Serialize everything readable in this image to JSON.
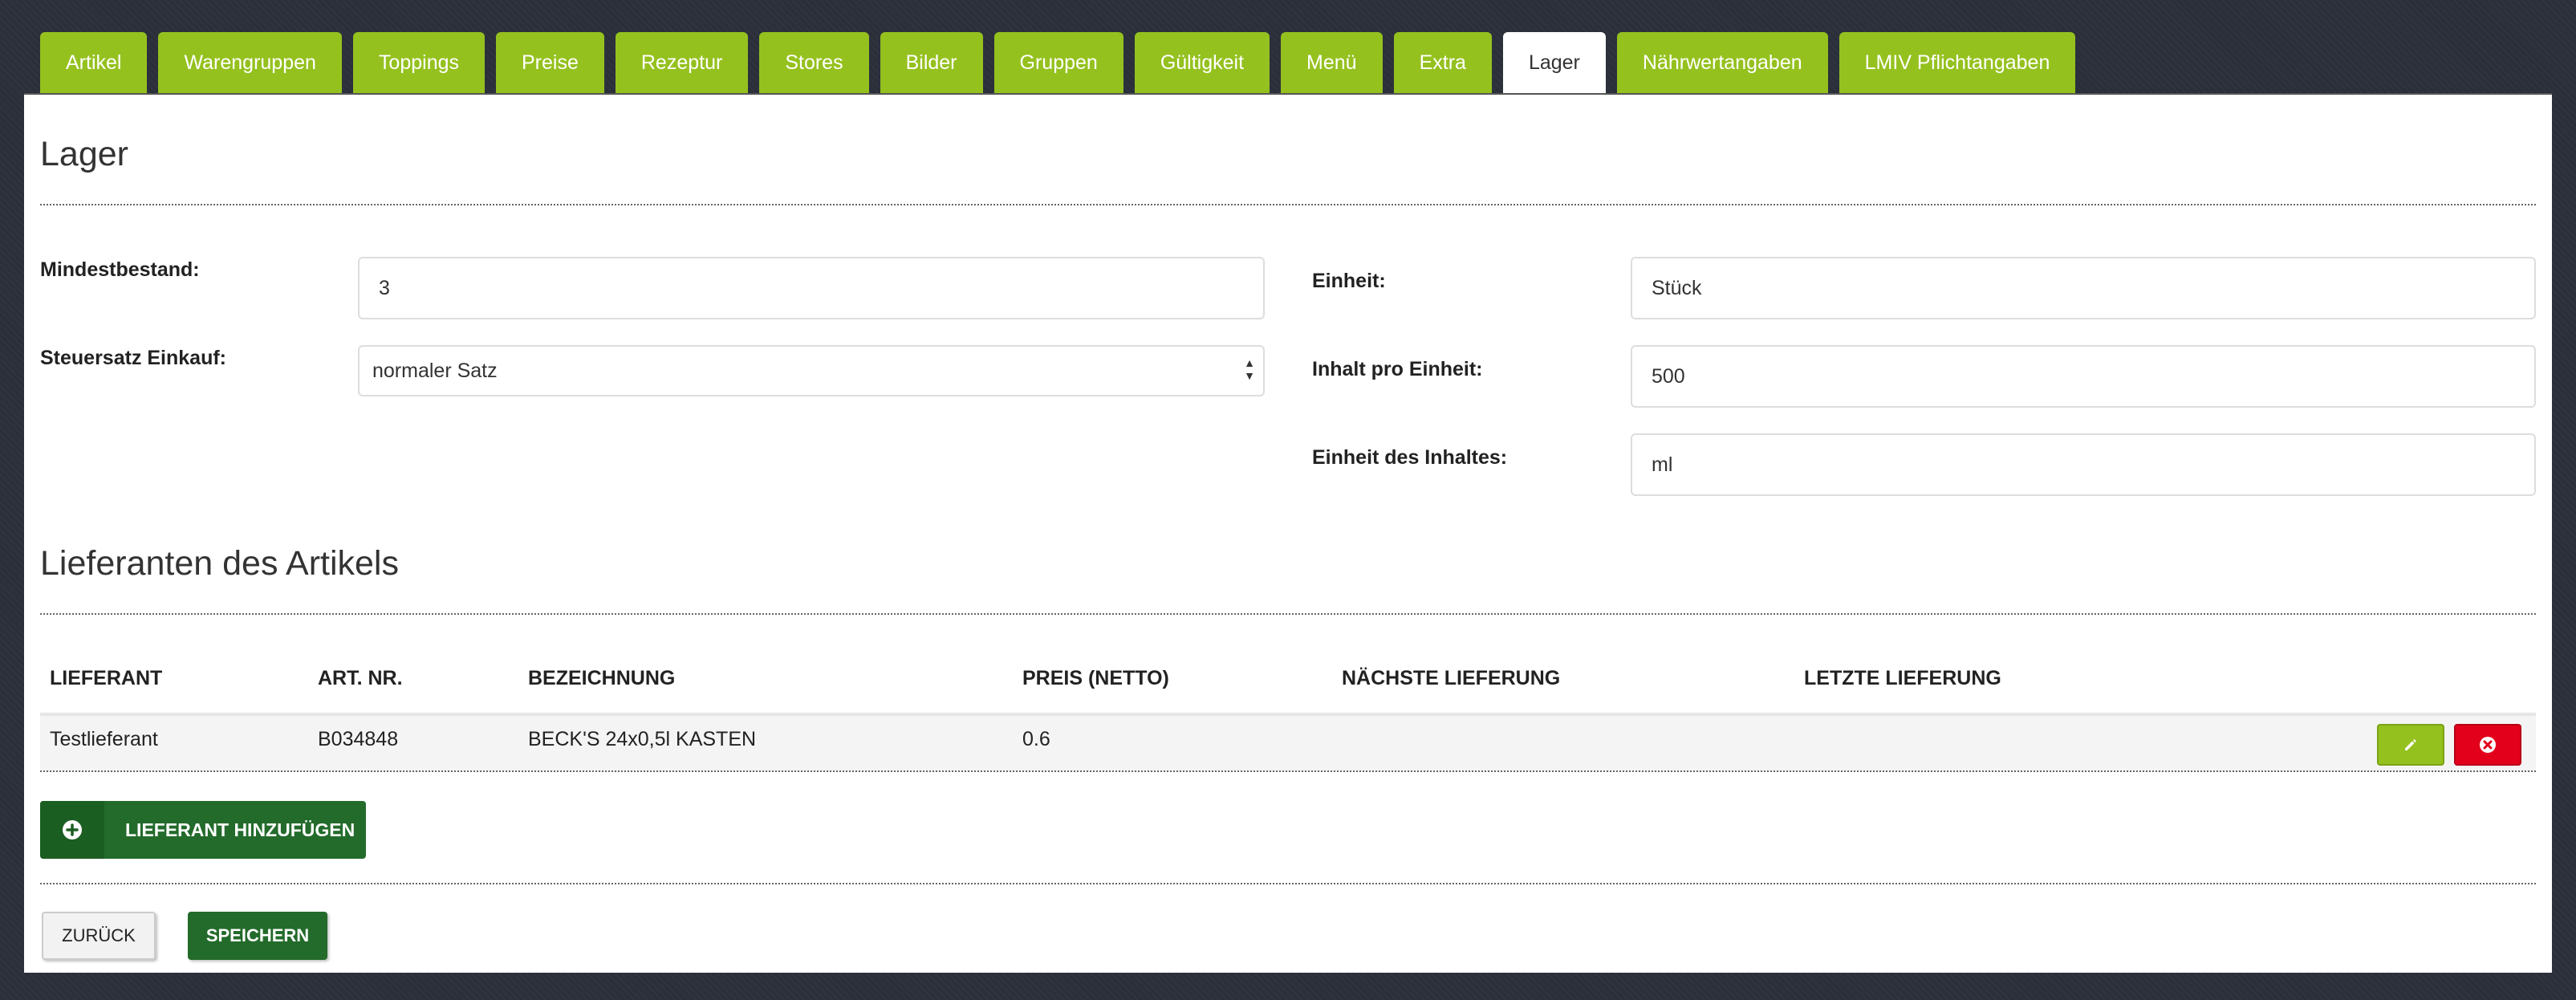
{
  "tabs": [
    {
      "label": "Artikel",
      "active": false
    },
    {
      "label": "Warengruppen",
      "active": false
    },
    {
      "label": "Toppings",
      "active": false
    },
    {
      "label": "Preise",
      "active": false
    },
    {
      "label": "Rezeptur",
      "active": false
    },
    {
      "label": "Stores",
      "active": false
    },
    {
      "label": "Bilder",
      "active": false
    },
    {
      "label": "Gruppen",
      "active": false
    },
    {
      "label": "Gültigkeit",
      "active": false
    },
    {
      "label": "Menü",
      "active": false
    },
    {
      "label": "Extra",
      "active": false
    },
    {
      "label": "Lager",
      "active": true
    },
    {
      "label": "Nährwertangaben",
      "active": false
    },
    {
      "label": "LMIV Pflichtangaben",
      "active": false
    }
  ],
  "lager": {
    "title": "Lager",
    "mindestbestand_label": "Mindestbestand:",
    "mindestbestand_value": "3",
    "steuersatz_label": "Steuersatz Einkauf:",
    "steuersatz_value": "normaler Satz",
    "einheit_label": "Einheit:",
    "einheit_value": "Stück",
    "inhalt_label": "Inhalt pro Einheit:",
    "inhalt_value": "500",
    "einheit_inhalt_label": "Einheit des Inhaltes:",
    "einheit_inhalt_value": "ml"
  },
  "lieferanten": {
    "title": "Lieferanten des Artikels",
    "columns": [
      "Lieferant",
      "Art. Nr.",
      "Bezeichnung",
      "Preis (Netto)",
      "Nächste Lieferung",
      "Letzte Lieferung"
    ],
    "rows": [
      {
        "lieferant": "Testlieferant",
        "art_nr": "B034848",
        "bezeichnung": "BECK'S 24x0,5l KASTEN",
        "preis": "0.6",
        "naechste": "",
        "letzte": ""
      }
    ],
    "add_label": "Lieferant hinzufügen"
  },
  "actions": {
    "back_label": "Zurück",
    "save_label": "Speichern"
  },
  "colors": {
    "accent_green": "#95c11f",
    "dark_green": "#236b2b",
    "delete_red": "#e3001b"
  },
  "icons": {
    "edit": "pencil-icon",
    "delete": "close-circle-icon",
    "add": "plus-circle-icon",
    "select": "select-caret-icon"
  }
}
